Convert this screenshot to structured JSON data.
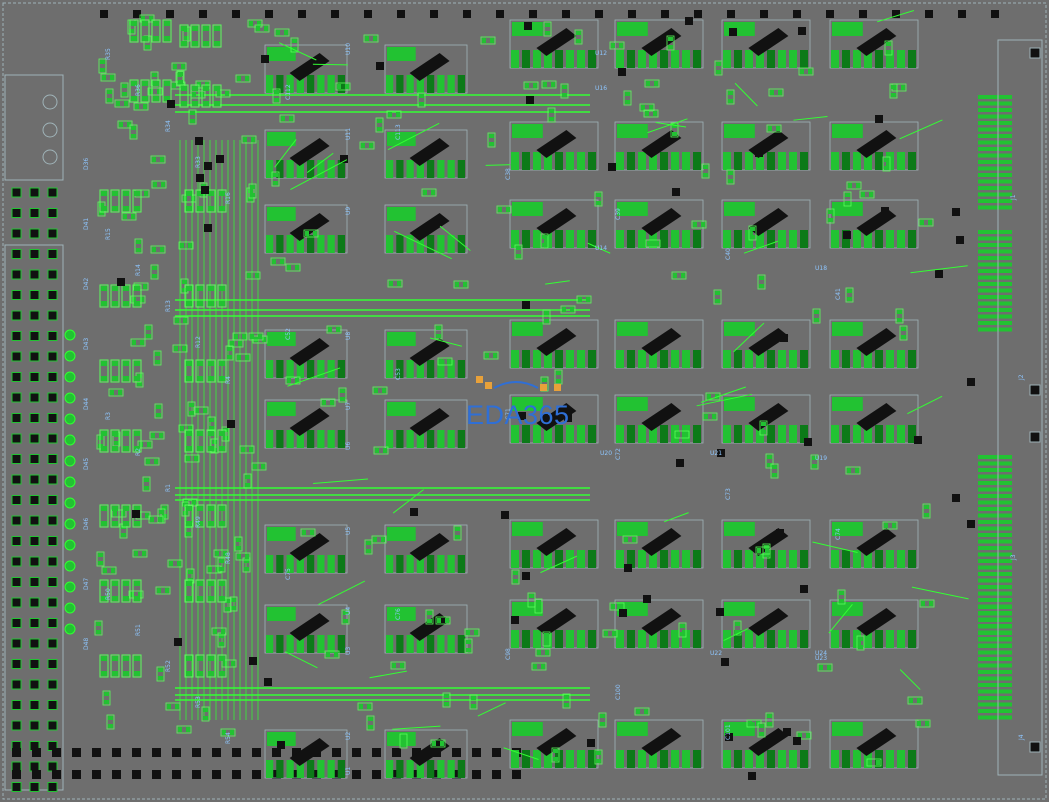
{
  "watermark": {
    "brand": "EDA365",
    "colors": {
      "blue": "#2f6fd6",
      "orange": "#e8a13a"
    }
  },
  "colors": {
    "board": "#6e6e6e",
    "copper": "#22c232",
    "copper_dark": "#0c7a18",
    "trace": "#33ff33",
    "silk_green": "#5cff5c",
    "silk_blue": "#8ec6ff",
    "outline": "#9fb3b8",
    "pad_black": "#111111",
    "drill": "#1c1c1c"
  },
  "designators": {
    "column1": [
      "U10",
      "U11",
      "U9",
      "U8",
      "U7",
      "U6",
      "U5",
      "U4",
      "U3",
      "U2",
      "U1"
    ],
    "column2": [
      "U12",
      "U16",
      "U14",
      "U18",
      "U19",
      "U20",
      "U21",
      "U22",
      "U23",
      "U24"
    ],
    "resistors": [
      "R35",
      "R36",
      "R34",
      "R33",
      "R16",
      "R15",
      "R14",
      "R13",
      "R12",
      "R4",
      "R3",
      "R2",
      "R1",
      "R49",
      "R48",
      "R50",
      "R51",
      "R52",
      "R53",
      "R54"
    ],
    "capacitors": [
      "C112",
      "C113",
      "C38",
      "C39",
      "C40",
      "C41",
      "C52",
      "C53",
      "C71",
      "C72",
      "C73",
      "C74",
      "C75",
      "C76",
      "C98",
      "C100",
      "C101"
    ],
    "diodes": [
      "D36",
      "D41",
      "D42",
      "D43",
      "D44",
      "D45",
      "D46",
      "D47",
      "D48"
    ],
    "connectors": [
      "J1",
      "J2",
      "J3",
      "J4"
    ]
  }
}
